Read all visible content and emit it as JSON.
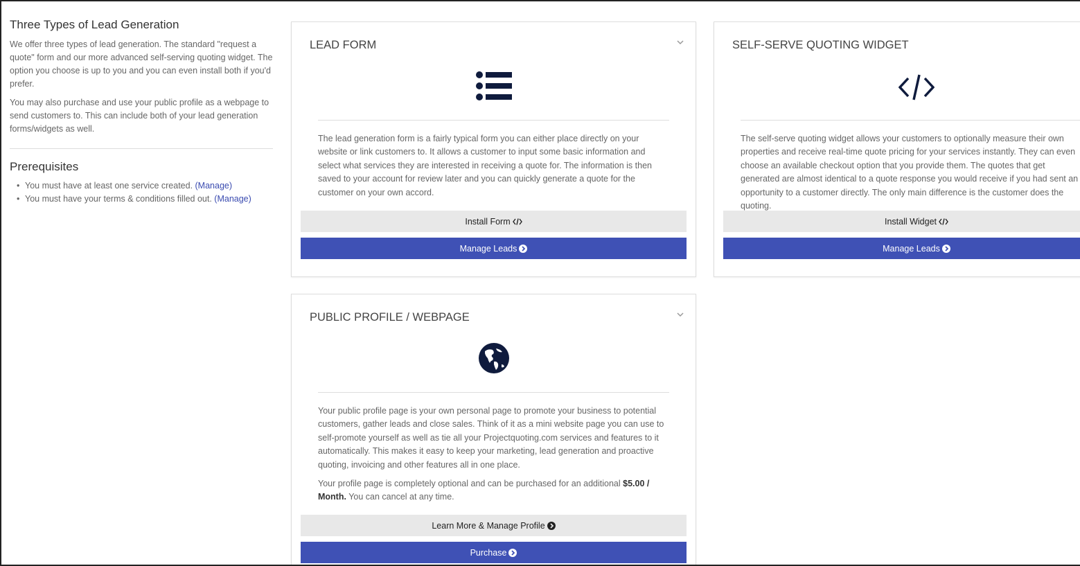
{
  "sidebar": {
    "title": "Three Types of Lead Generation",
    "intro_p1": "We offer three types of lead generation. The standard \"request a quote\" form and our more advanced self-serving quoting widget. The option you choose is up to you and you can even install both if you'd prefer.",
    "intro_p2": "You may also purchase and use your public profile as a webpage to send customers to. This can include both of your lead generation forms/widgets as well.",
    "prereq_title": "Prerequisites",
    "prereqs": [
      {
        "text": "You must have at least one service created. ",
        "link": "(Manage)"
      },
      {
        "text": "You must have your terms & conditions filled out. ",
        "link": "(Manage)"
      }
    ]
  },
  "cards": {
    "lead_form": {
      "title": "LEAD FORM",
      "icon": "list-icon",
      "body": "The lead generation form is a fairly typical form you can either place directly on your website or link customers to. It allows a customer to input some basic information and select what services they are interested in receiving a quote for. The information is then saved to your account for review later and you can quickly generate a quote for the customer on your own accord.",
      "btn_install": "Install Form",
      "btn_manage": "Manage Leads"
    },
    "widget": {
      "title": "SELF-SERVE QUOTING WIDGET",
      "icon": "code-icon",
      "body": "The self-serve quoting widget allows your customers to optionally measure their own properties and receive real-time quote pricing for your services instantly. They can even choose an available checkout option that you provide them. The quotes that get generated are almost identical to a quote response you would receive if you had sent an opportunity to a customer directly. The only main difference is the customer does the quoting.",
      "btn_install": "Install Widget",
      "btn_manage": "Manage Leads"
    },
    "profile": {
      "title": "PUBLIC PROFILE / WEBPAGE",
      "icon": "globe-icon",
      "body_p1": "Your public profile page is your own personal page to promote your business to potential customers, gather leads and close sales. Think of it as a mini website page you can use to self-promote yourself as well as tie all your Projectquoting.com services and features to it automatically. This makes it easy to keep your marketing, lead generation and proactive quoting, invoicing and other features all in one place.",
      "body_p2_pre": "Your profile page is completely optional and can be purchased for an additional ",
      "body_p2_price": "$5.00 / Month.",
      "body_p2_post": " You can cancel at any time.",
      "btn_learn": "Learn More & Manage Profile",
      "btn_purchase": "Purchase"
    }
  },
  "colors": {
    "accent": "#3f51b5",
    "icon": "#0f1b3d",
    "link": "#3a4bb0"
  }
}
